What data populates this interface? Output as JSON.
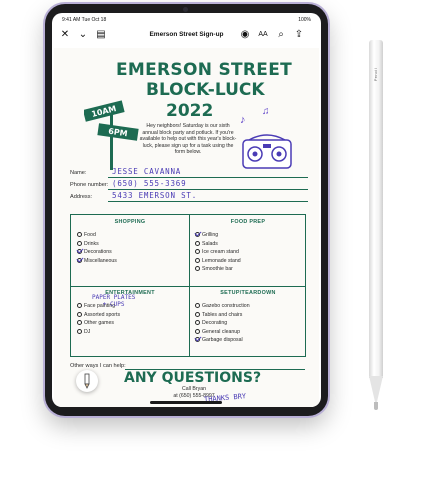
{
  "status": {
    "time": "9:41 AM",
    "date": "Tue Oct 18",
    "battery": "100%"
  },
  "toolbar": {
    "title": "Emerson Street Sign-up"
  },
  "flyer": {
    "headline_line1": "EMERSON STREET",
    "headline_line2": "BLOCK-LUCK",
    "headline_line3": "2022",
    "sign_time_1": "10AM",
    "sign_time_2": "6PM",
    "intro_text": "Hey neighbors! Saturday is our sixth annual block party and potluck. If you're available to help out with this year's block-luck, please sign up for a task using the form below.",
    "fields": {
      "name_label": "Name:",
      "name_value": "JESSE CAVANNA",
      "phone_label": "Phone number:",
      "phone_value": "(650) 555-3369",
      "address_label": "Address:",
      "address_value": "5433 EMERSON ST."
    },
    "sections": {
      "shopping": {
        "title": "SHOPPING",
        "items": [
          "Food",
          "Drinks",
          "Decorations",
          "Miscellaneous"
        ],
        "checked": [
          false,
          false,
          true,
          true
        ]
      },
      "food_prep": {
        "title": "FOOD PREP",
        "items": [
          "Grilling",
          "Salads",
          "Ice cream stand",
          "Lemonade stand",
          "Smoothie bar"
        ],
        "checked": [
          true,
          false,
          false,
          false,
          false
        ]
      },
      "entertainment": {
        "title": "ENTERTAINMENT",
        "items": [
          "Face painting",
          "Assorted sports",
          "Other games",
          "DJ"
        ],
        "checked": [
          false,
          false,
          false,
          false
        ]
      },
      "setup": {
        "title": "SETUP/TEARDOWN",
        "items": [
          "Gazebo construction",
          "Tables and chairs",
          "Decorating",
          "General cleanup",
          "Garbage disposal"
        ],
        "checked": [
          false,
          false,
          false,
          false,
          true
        ]
      }
    },
    "misc_handwriting_1": "PAPER PLATES",
    "misc_handwriting_2": "+ CUPS",
    "other_label": "Other ways I can help:",
    "questions": "ANY QUESTIONS?",
    "call_line1": "Call Bryan",
    "call_line2": "at (650) 555-8997",
    "thanks": "THANKS BRY"
  },
  "pencil": {
    "brand": "Pencil"
  }
}
